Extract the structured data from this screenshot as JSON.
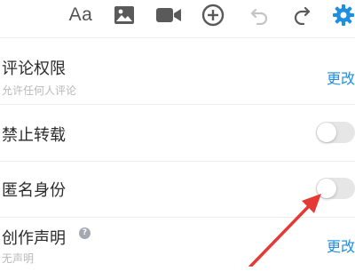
{
  "toolbar": {
    "font_label": "Aa",
    "icons": [
      "font-size-icon",
      "image-icon",
      "video-icon",
      "add-circle-icon",
      "undo-icon",
      "redo-icon",
      "settings-gear-icon"
    ],
    "accent_color": "#1f8fe0"
  },
  "settings": {
    "comment_permission": {
      "title": "评论权限",
      "subtitle": "允许任何人评论",
      "action": "更改"
    },
    "no_repost": {
      "title": "禁止转载",
      "enabled": false
    },
    "anonymous": {
      "title": "匿名身份",
      "enabled": false
    },
    "creation_statement": {
      "title": "创作声明",
      "help_glyph": "?",
      "subtitle": "无声明",
      "action": "更改"
    }
  },
  "annotation": {
    "color": "#e53935",
    "points_to": "anonymous-toggle"
  }
}
